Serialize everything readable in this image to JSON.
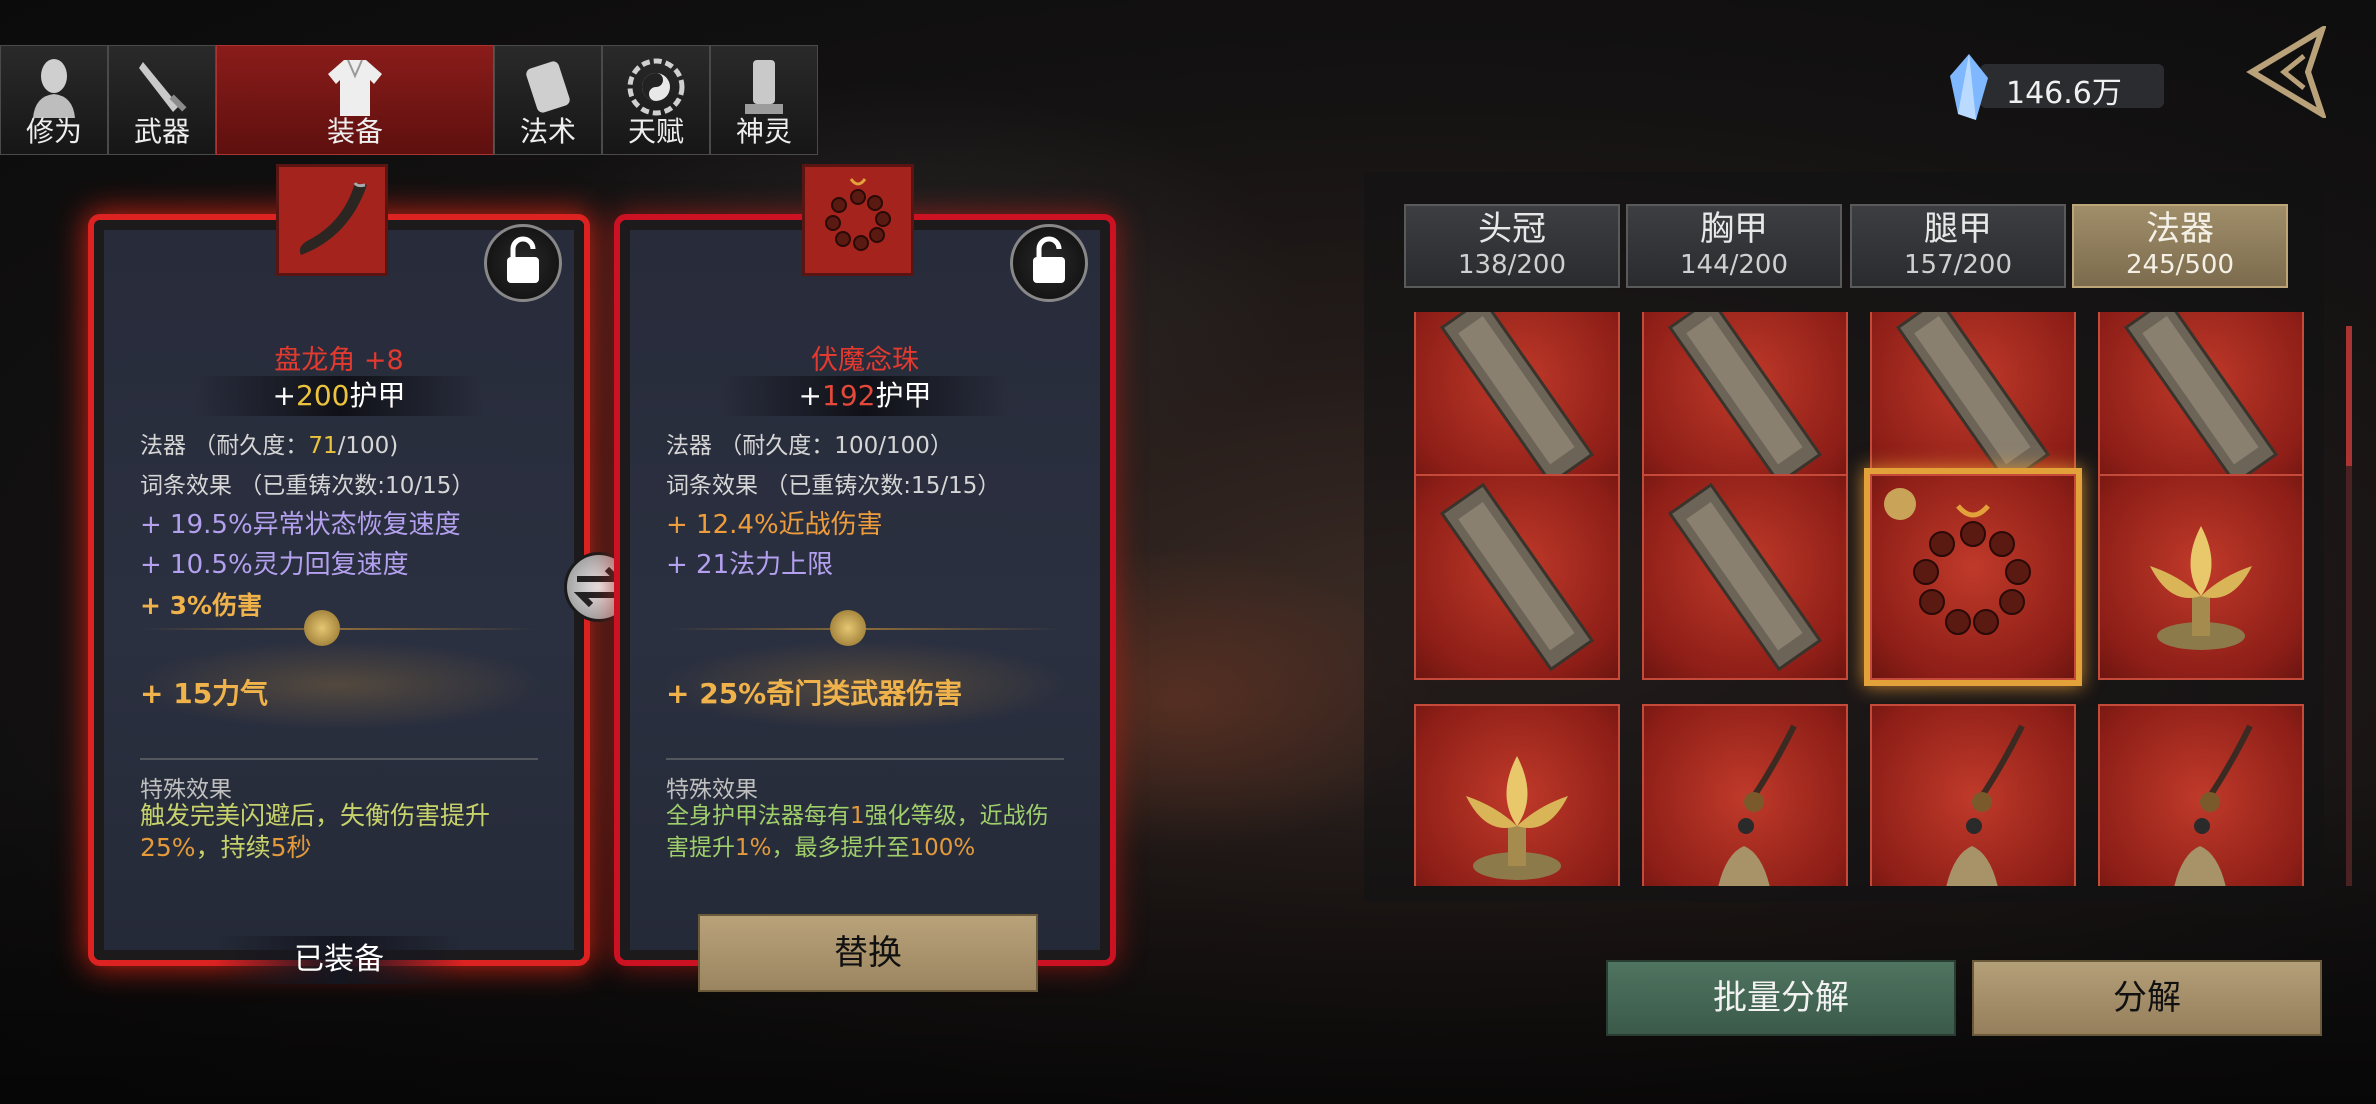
{
  "tabs": [
    {
      "label": "修为",
      "icon": "cultivation-figure-icon"
    },
    {
      "label": "武器",
      "icon": "sword-icon"
    },
    {
      "label": "装备",
      "icon": "robe-icon",
      "active": true
    },
    {
      "label": "法术",
      "icon": "scroll-icon"
    },
    {
      "label": "天赋",
      "icon": "bagua-icon"
    },
    {
      "label": "神灵",
      "icon": "tablet-icon"
    }
  ],
  "currency": {
    "value": "146.6万",
    "icon": "crystal-icon"
  },
  "equipped_card": {
    "name": "盘龙角  +8",
    "armor_prefix": "+",
    "armor_value": "200",
    "armor_label": "护甲",
    "type_line": "法器  （耐久度：",
    "durability_current": "71",
    "durability_rest": "/100)",
    "affix_line": "词条效果  （已重铸次数:10/15）",
    "affixes": [
      "+ 19.5%异常状态恢复速度",
      "+ 10.5%灵力回复速度"
    ],
    "bonus_small": "+ 3%伤害",
    "main_bonus": "+ 15力气",
    "special_title": "特殊效果",
    "special_a": "触发完美闪避后，失衡伤害提升",
    "special_pct": "25%",
    "special_b": "，持续",
    "special_dur": "5秒",
    "status": "已装备"
  },
  "compare_card": {
    "name": "伏魔念珠",
    "armor_prefix": "+",
    "armor_value": "192",
    "armor_label": "护甲",
    "type_line": "法器  （耐久度：100/100）",
    "affix_line": "词条效果  （已重铸次数:15/15）",
    "affix_1": "+ 12.4%近战伤害",
    "affix_2": "+ 21法力上限",
    "main_bonus": "+ 25%奇门类武器伤害",
    "special_title": "特殊效果",
    "special_a": "全身护甲法器每有",
    "special_n1": "1",
    "special_b": "强化等级，近战伤害提升",
    "special_n2": "1%",
    "special_c": "，最多提升至",
    "special_n3": "100%",
    "replace_label": "替换"
  },
  "categories": [
    {
      "name": "头冠",
      "count": "138/200"
    },
    {
      "name": "胸甲",
      "count": "144/200"
    },
    {
      "name": "腿甲",
      "count": "157/200"
    },
    {
      "name": "法器",
      "count": "245/500",
      "active": true
    }
  ],
  "inventory": [
    {
      "item": "talisman-tablet"
    },
    {
      "item": "talisman-tablet"
    },
    {
      "item": "talisman-tablet"
    },
    {
      "item": "talisman-tablet"
    },
    {
      "item": "talisman-tablet"
    },
    {
      "item": "talisman-tablet"
    },
    {
      "item": "prayer-beads",
      "selected": true
    },
    {
      "item": "lotus-lamp"
    },
    {
      "item": "lotus-lamp"
    },
    {
      "item": "bell-pendant"
    },
    {
      "item": "bell-pendant"
    },
    {
      "item": "bell-pendant"
    }
  ],
  "buttons": {
    "batch_decompose": "批量分解",
    "decompose": "分解"
  },
  "colors": {
    "accent_red": "#a4231d",
    "gold": "#f0b24a",
    "purple": "#b3a0ee",
    "selected_glow": "#e3a13a"
  }
}
